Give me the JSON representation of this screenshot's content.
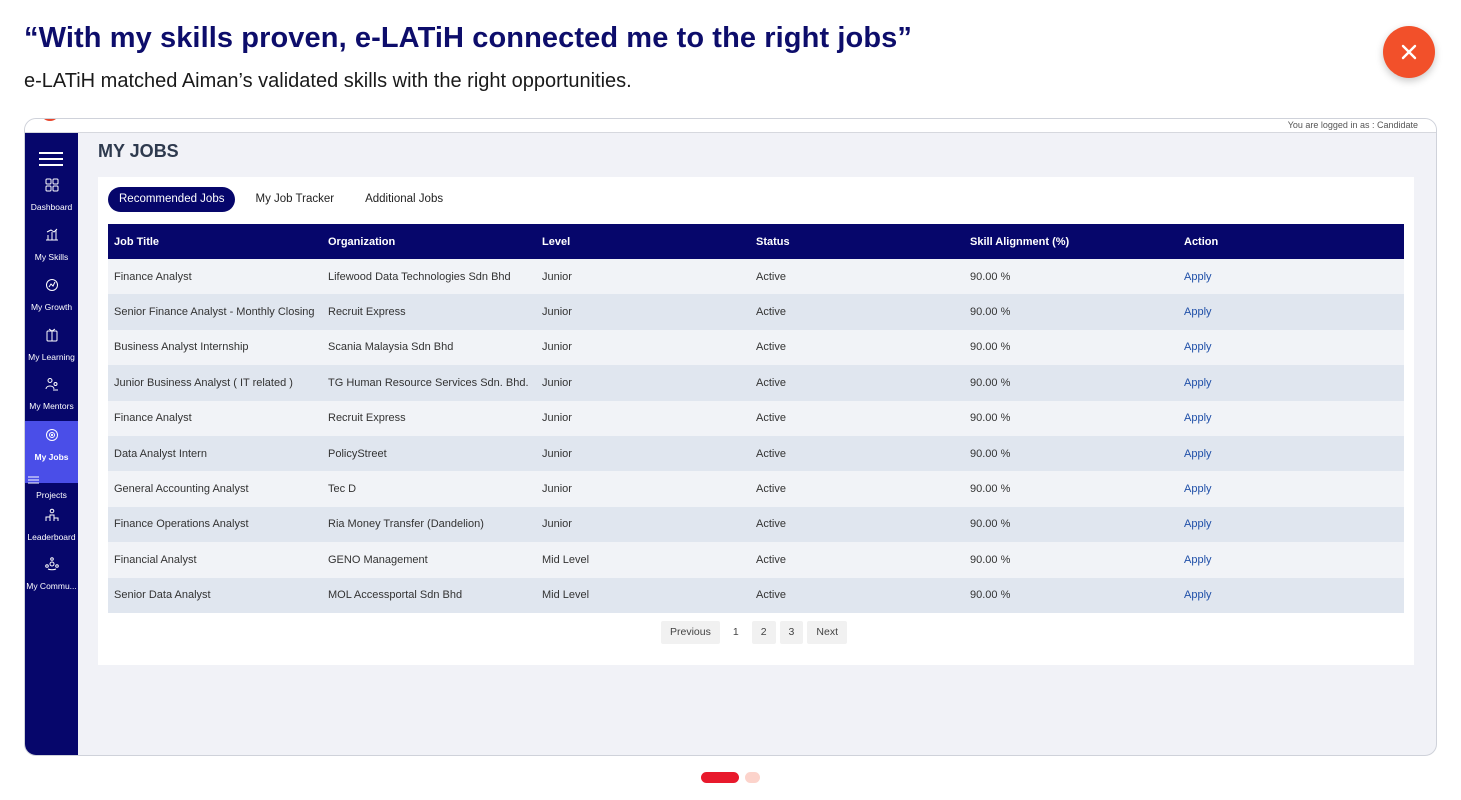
{
  "header": {
    "headline": "“With my skills proven, e-LATiH connected me to the right jobs”",
    "subline": "e-LATiH matched Aiman’s validated skills with the right opportunities."
  },
  "app": {
    "logged_in_text": "You are logged in as : Candidate",
    "page_title": "MY JOBS",
    "sidebar": [
      {
        "label": "Dashboard",
        "icon": "grid-icon"
      },
      {
        "label": "My Skills",
        "icon": "skills-icon"
      },
      {
        "label": "My Growth",
        "icon": "growth-icon"
      },
      {
        "label": "My Learning",
        "icon": "learning-icon"
      },
      {
        "label": "My Mentors",
        "icon": "mentors-icon"
      },
      {
        "label": "My Jobs",
        "icon": "target-icon"
      },
      {
        "label": "Projects",
        "icon": "projects-icon"
      },
      {
        "label": "Leaderboard",
        "icon": "leaderboard-icon"
      },
      {
        "label": "My Commu...",
        "icon": "community-icon"
      }
    ],
    "tabs": [
      "Recommended Jobs",
      "My Job Tracker",
      "Additional Jobs"
    ],
    "table": {
      "columns": [
        "Job Title",
        "Organization",
        "Level",
        "Status",
        "Skill Alignment (%)",
        "Action"
      ],
      "rows": [
        [
          "Finance Analyst",
          "Lifewood Data Technologies Sdn Bhd",
          "Junior",
          "Active",
          "90.00 %",
          "Apply"
        ],
        [
          "Senior Finance Analyst - Monthly Closing",
          "Recruit Express",
          "Junior",
          "Active",
          "90.00 %",
          "Apply"
        ],
        [
          "Business Analyst Internship",
          "Scania Malaysia Sdn Bhd",
          "Junior",
          "Active",
          "90.00 %",
          "Apply"
        ],
        [
          "Junior Business Analyst ( IT related )",
          "TG Human Resource Services Sdn. Bhd.",
          "Junior",
          "Active",
          "90.00 %",
          "Apply"
        ],
        [
          "Finance Analyst",
          "Recruit Express",
          "Junior",
          "Active",
          "90.00 %",
          "Apply"
        ],
        [
          "Data Analyst Intern",
          "PolicyStreet",
          "Junior",
          "Active",
          "90.00 %",
          "Apply"
        ],
        [
          "General Accounting Analyst",
          "Tec D",
          "Junior",
          "Active",
          "90.00 %",
          "Apply"
        ],
        [
          "Finance Operations Analyst",
          "Ria Money Transfer (Dandelion)",
          "Junior",
          "Active",
          "90.00 %",
          "Apply"
        ],
        [
          "Financial Analyst",
          "GENO Management",
          "Mid Level",
          "Active",
          "90.00 %",
          "Apply"
        ],
        [
          "Senior Data Analyst",
          "MOL Accessportal Sdn Bhd",
          "Mid Level",
          "Active",
          "90.00 %",
          "Apply"
        ]
      ]
    },
    "pagination": {
      "previous": "Previous",
      "pages": [
        "1",
        "2",
        "3"
      ],
      "next": "Next"
    }
  },
  "colors": {
    "navy": "#06066b",
    "close": "#f2502a",
    "active_nav": "#4a4ee8",
    "link": "#1f4fa8",
    "carousel_active": "#e8192c"
  }
}
